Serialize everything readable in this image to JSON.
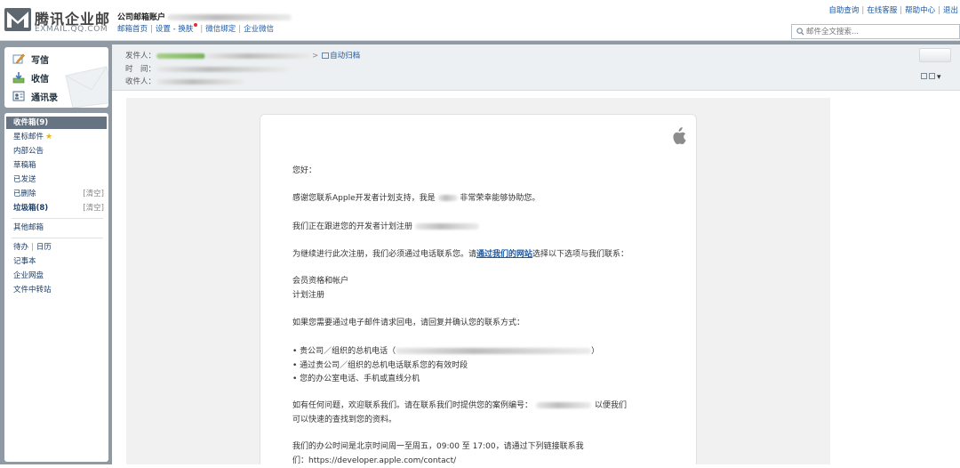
{
  "header": {
    "logo_name": "腾讯企业邮",
    "logo_sub": "EXMAIL.QQ.COM",
    "account_label": "公司邮箱账户",
    "nav": [
      "邮箱首页",
      "设置 - 换肤",
      "微信绑定",
      "企业微信"
    ],
    "top_links": [
      "自助查询",
      "在线客服",
      "帮助中心",
      "退出"
    ],
    "search_placeholder": "邮件全文搜索..."
  },
  "quick_actions": {
    "compose": "写信",
    "inbox": "收信",
    "contacts": "通讯录"
  },
  "folders": [
    {
      "label": "收件箱(9)",
      "active": true
    },
    {
      "label": "星标邮件"
    },
    {
      "label": "内部公告"
    },
    {
      "label": "草稿箱"
    },
    {
      "label": "已发送"
    },
    {
      "label": "已删除",
      "action": "[清空]"
    },
    {
      "label": "垃圾箱(8)",
      "action": "[清空]"
    }
  ],
  "other_folders": {
    "other_mailbox": "其他邮箱",
    "todo": "待办",
    "calendar": "日历",
    "notes": "记事本",
    "netdisk": "企业网盘",
    "transfer": "文件中转站"
  },
  "message_header": {
    "from_label": "发件人：",
    "time_label": "时　间：",
    "to_label": "收件人：",
    "auto_archive": "自动归档"
  },
  "email_body": {
    "greeting": "您好：",
    "p1_a": "感谢您联系Apple开发者计划支持，我是",
    "p1_b": "非常荣幸能够协助您。",
    "p2": "我们正在跟进您的开发者计划注册",
    "p3_a": "为继续进行此次注册，我们必须通过电话联系您。请",
    "p3_link": "通过我们的网站",
    "p3_b": "选择以下选项与我们联系：",
    "opt1": "会员资格和帐户",
    "opt2": "计划注册",
    "p4": "如果您需要通过电子邮件请求回电，请回复并确认您的联系方式：",
    "bullet1_a": "• 贵公司／组织的总机电话（",
    "bullet1_b": "）",
    "bullet2": "• 通过贵公司／组织的总机电话联系您的有效时段",
    "bullet3": "• 您的办公室电话、手机或直线分机",
    "p5_a": "如有任何问题，欢迎联系我们。请在联系我们时提供您的案例编号：",
    "p5_b": "以便我们",
    "p5_c": "可以快速的查找到您的资料。",
    "p6_a": "我们的办公时间是北京时间周一至周五，09:00 至 17:00，请通过下列链接联系我",
    "p6_b": "们：https://developer.apple.com/contact/"
  },
  "colors": {
    "accent": "#1c5aa6",
    "sidebar_bg": "#8f9aa5",
    "active_folder": "#657382"
  }
}
